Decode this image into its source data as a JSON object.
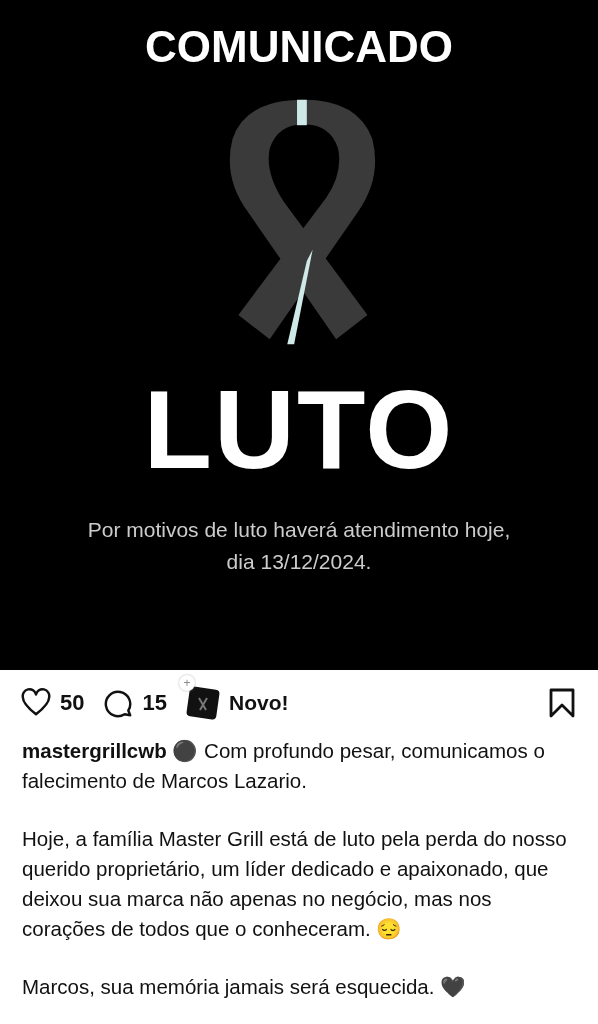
{
  "post_image": {
    "heading": "COMUNICADO",
    "title": "LUTO",
    "subtitle": "Por motivos de luto haverá atendimento hoje, dia 13/12/2024."
  },
  "actions": {
    "likes": "50",
    "comments": "15",
    "badge": "+",
    "new_label": "Novo!",
    "saved": false
  },
  "caption": {
    "first": "**mastergrillcwb** ⚫ Com profundo pesar, comunicamos o falecimento de Marcos Lazario.",
    "paragraphs": [
      "Hoje, a família Master Grill está de luto pela perda do nosso querido proprietário, um líder dedicado e apaixonado, que deixou sua marca não apenas no negócio, mas nos corações de todos que o conheceram. 😔",
      "Marcos, sua memória jamais será esquecida. 🖤"
    ]
  }
}
